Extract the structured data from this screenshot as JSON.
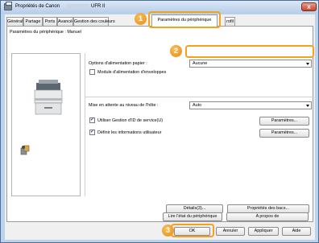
{
  "window": {
    "title": "Propriétés de Canon",
    "title_model": "",
    "title_variant": "UFR II",
    "close_label": "x"
  },
  "tabs": [
    {
      "label": "Général"
    },
    {
      "label": "Partage"
    },
    {
      "label": "Ports"
    },
    {
      "label": "Avancé"
    },
    {
      "label": "Gestion des couleurs"
    },
    {
      "label": "Paramètres du périphérique"
    },
    {
      "label": "rofil"
    }
  ],
  "panel": {
    "heading": "Paramètres du périphérique : Manuel",
    "paper_source_options_label": "Options d'alimentation papier :",
    "paper_source_options_value": "Aucune",
    "envelope_module_label": "Module d'alimentation d'enveloppes",
    "envelope_module_checked": false,
    "host_spooling_label": "Mise en attente au niveau de l'hôte :",
    "host_spooling_value": "Auto",
    "department_id_label": "Utiliser Gestion d'ID de service(U)",
    "department_id_checked": true,
    "user_info_label": "Définir les informations utilisateur",
    "user_info_checked": true,
    "settings_button_1": "Paramètres...",
    "settings_button_2": "Paramètres...",
    "details_button": "Détails(3)...",
    "bin_properties_button": "Propriétés des bacs...",
    "read_status_button": "Lire l'état du périphérique",
    "about_button": "A propos de"
  },
  "footer": {
    "ok": "OK",
    "cancel": "Annuler",
    "apply": "Appliquer",
    "help": "Aide"
  },
  "callouts": {
    "one": "1",
    "two": "2",
    "three": "3"
  },
  "colors": {
    "accent_highlight": "#f3a21d",
    "window_frame": "#bcd3ee"
  }
}
